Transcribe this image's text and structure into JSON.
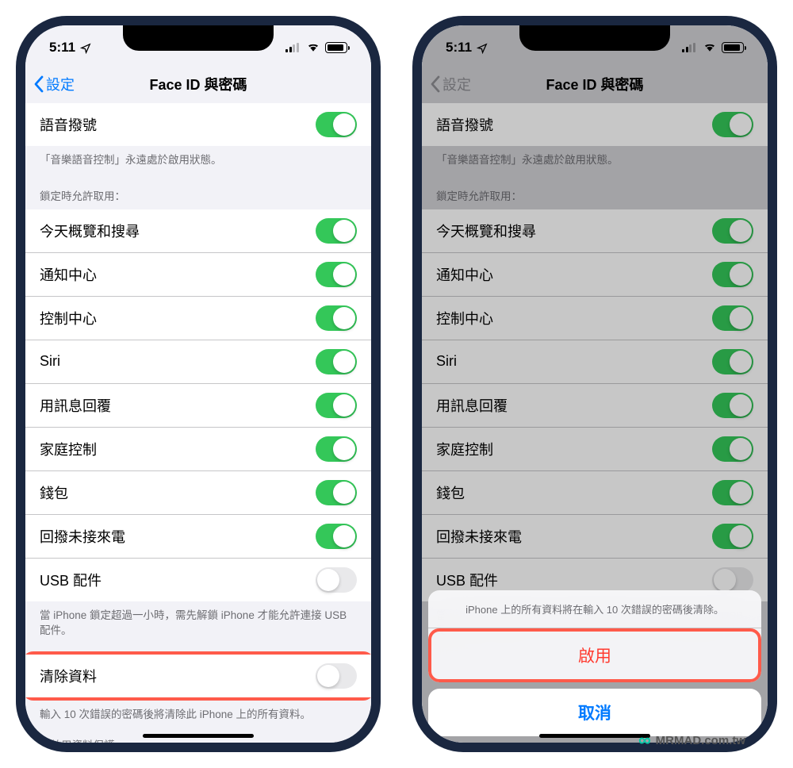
{
  "status": {
    "time": "5:11"
  },
  "nav": {
    "back": "設定",
    "title": "Face ID 與密碼"
  },
  "voiceDial": {
    "label": "語音撥號",
    "on": true
  },
  "voiceFooter": "「音樂語音控制」永遠處於啟用狀態。",
  "lockedHeader": "鎖定時允許取用：",
  "lockedItems": [
    {
      "label": "今天概覽和搜尋",
      "on": true
    },
    {
      "label": "通知中心",
      "on": true
    },
    {
      "label": "控制中心",
      "on": true
    },
    {
      "label": "Siri",
      "on": true
    },
    {
      "label": "用訊息回覆",
      "on": true
    },
    {
      "label": "家庭控制",
      "on": true
    },
    {
      "label": "錢包",
      "on": true
    },
    {
      "label": "回撥未接來電",
      "on": true
    },
    {
      "label": "USB 配件",
      "on": false
    }
  ],
  "usbFooter": "當 iPhone 鎖定超過一小時，需先解鎖 iPhone 才能允許連接 USB 配件。",
  "erase": {
    "label": "清除資料",
    "on": false
  },
  "eraseFooter": "輸入 10 次錯誤的密碼後將清除此 iPhone 上的所有資料。",
  "protectFooter": "已啟用資料保護。",
  "sheet": {
    "msg": "iPhone 上的所有資料將在輸入 10 次錯誤的密碼後清除。",
    "enable": "啟用",
    "cancel": "取消"
  },
  "watermark": "MRMAD.com.tw"
}
